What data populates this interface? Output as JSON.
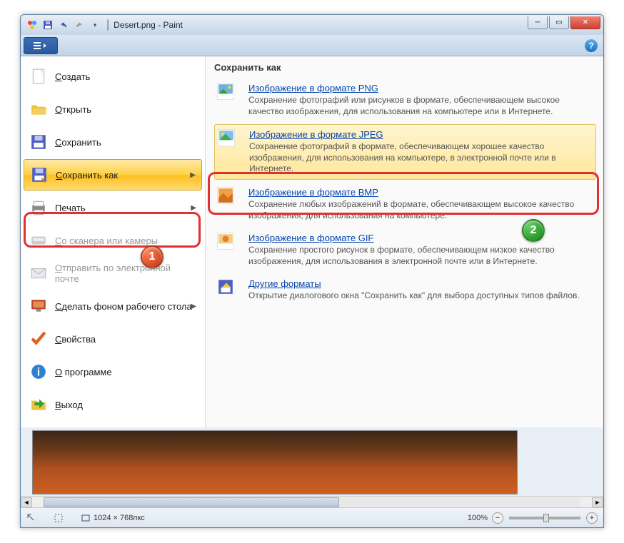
{
  "title": "Desert.png - Paint",
  "left_menu": [
    {
      "label": "Создать",
      "icon": "new"
    },
    {
      "label": "Открыть",
      "icon": "open"
    },
    {
      "label": "Сохранить",
      "icon": "save"
    },
    {
      "label": "Сохранить как",
      "icon": "saveas",
      "selected": true,
      "has_arrow": true
    },
    {
      "label": "Печать",
      "icon": "print",
      "has_arrow": true
    },
    {
      "label": "Со сканера или камеры",
      "icon": "scanner",
      "disabled": true
    },
    {
      "label": "Отправить по электронной почте",
      "icon": "mail",
      "disabled": true
    },
    {
      "label": "Сделать фоном рабочего стола",
      "icon": "desktop",
      "has_arrow": true
    },
    {
      "label": "Свойства",
      "icon": "props"
    },
    {
      "label": "О программе",
      "icon": "about"
    },
    {
      "label": "Выход",
      "icon": "exit"
    }
  ],
  "right_panel": {
    "title": "Сохранить как",
    "options": [
      {
        "title": "Изображение в формате PNG",
        "desc": "Сохранение фотографий или рисунков в формате, обеспечивающем высокое качество изображения, для использования на компьютере или в Интернете.",
        "icon": "png"
      },
      {
        "title": "Изображение в формате JPEG",
        "desc": "Сохранение фотографий в формате, обеспечивающем хорошее качество изображения, для использования на компьютере, в электронной почте или в Интернете.",
        "icon": "jpeg",
        "hover": true
      },
      {
        "title": "Изображение в формате BMP",
        "desc": "Сохранение любых изображений в формате, обеспечивающем высокое качество изображения, для использования на компьютере.",
        "icon": "bmp"
      },
      {
        "title": "Изображение в формате GIF",
        "desc": "Сохранение простого рисунок в формате, обеспечивающем низкое качество изображения, для использования в электронной почте или в Интернете.",
        "icon": "gif"
      },
      {
        "title": "Другие форматы",
        "desc": "Открытие диалогового окна \"Сохранить как\" для выбора доступных типов файлов.",
        "icon": "other"
      }
    ]
  },
  "badges": {
    "one": "1",
    "two": "2"
  },
  "status": {
    "dimensions": "1024 × 768пкс",
    "zoom": "100%"
  }
}
